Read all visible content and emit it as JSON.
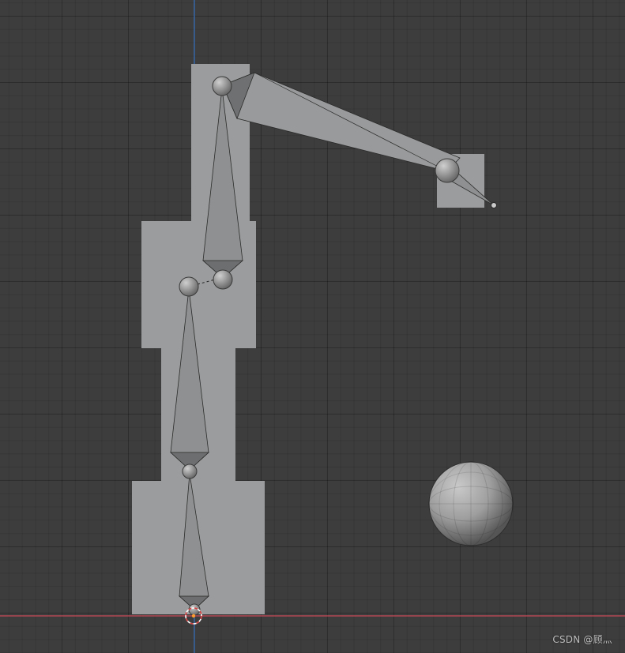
{
  "viewport": {
    "background": "#3d3d3d",
    "x_axis_color": "#c84a55",
    "y_axis_color": "#3b78c6"
  },
  "scene": {
    "mesh_color": "#9b9c9d",
    "bone_color": "#8c8d8e",
    "sphere_icon": "uv-sphere-icon",
    "cursor_icon": "3d-cursor-icon"
  },
  "watermark": {
    "text": "CSDN @顾灬"
  }
}
